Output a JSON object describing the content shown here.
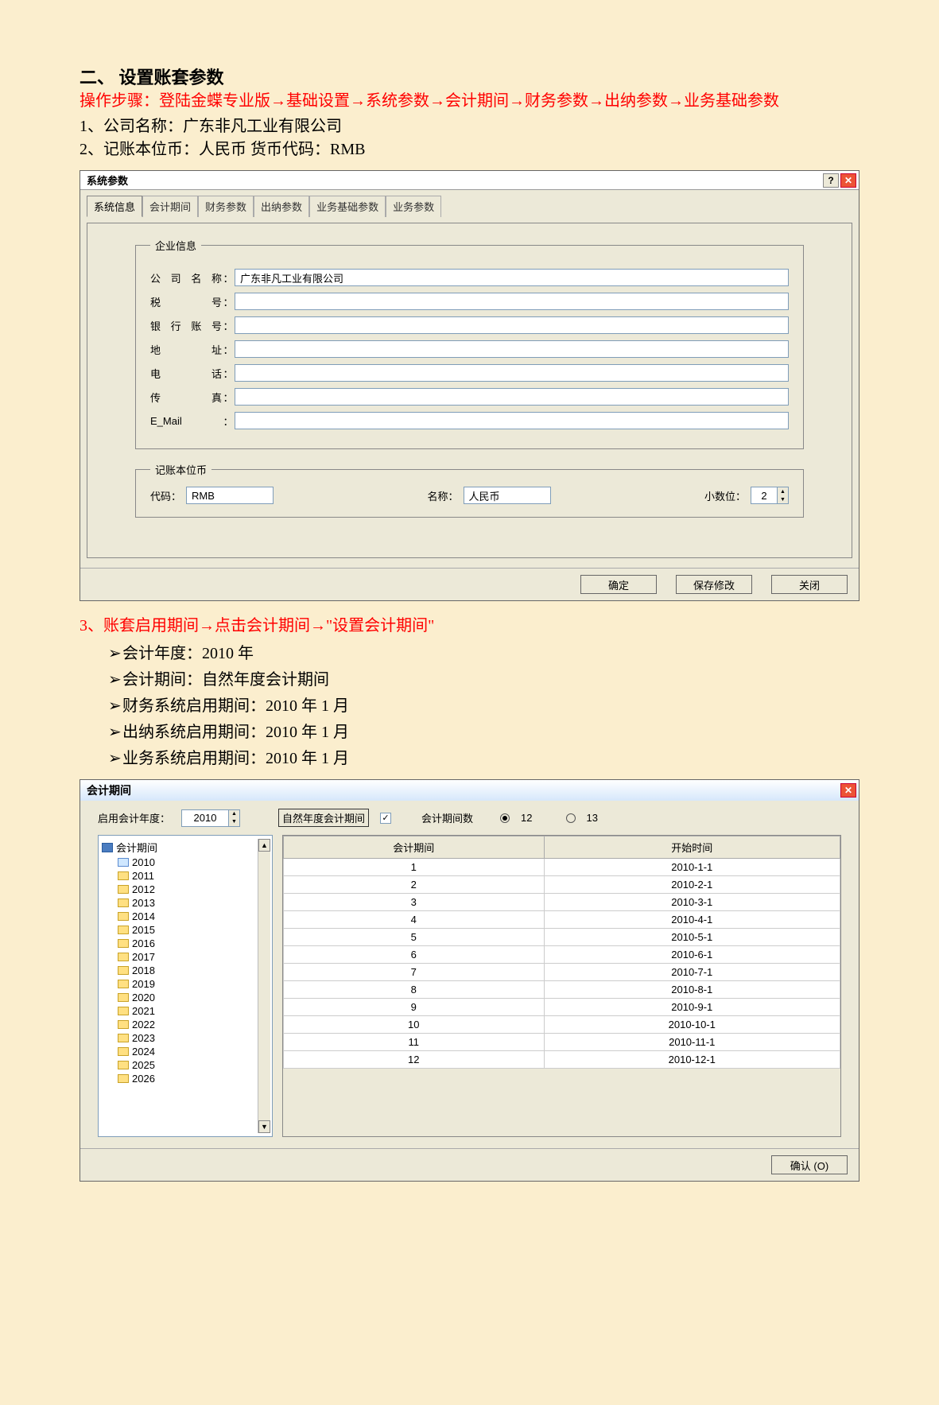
{
  "heading": "二、    设置账套参数",
  "steps_red": "操作步骤：登陆金蝶专业版→基础设置→系统参数→会计期间→财务参数→出纳参数→业务基础参数",
  "line1": "1、公司名称：广东非凡工业有限公司",
  "line2": "2、记账本位币：人民币     货币代码：RMB",
  "dlg1": {
    "title": "系统参数",
    "tabs": [
      "系统信息",
      "会计期间",
      "财务参数",
      "出纳参数",
      "业务基础参数",
      "业务参数"
    ],
    "group1": "企业信息",
    "labels": {
      "company": "公司名称",
      "tax": "税      号",
      "bank": "银行账号",
      "addr": "地      址",
      "tel": "电      话",
      "fax": "传      真",
      "email": "E_Mail"
    },
    "company_value": "广东非凡工业有限公司",
    "group2": "记账本位币",
    "code_label": "代码：",
    "code_value": "RMB",
    "name_label": "名称：",
    "name_value": "人民币",
    "dec_label": "小数位：",
    "dec_value": "2",
    "btns": {
      "ok": "确定",
      "save": "保存修改",
      "close": "关闭"
    }
  },
  "line3_red": "3、账套启用期间→点击会计期间→\"设置会计期间\"",
  "bullets": [
    "会计年度：2010 年",
    "会计期间：自然年度会计期间",
    "财务系统启用期间：2010 年 1 月",
    "出纳系统启用期间：2010 年 1 月",
    "业务系统启用期间：2010 年 1 月"
  ],
  "dlg2": {
    "title": "会计期间",
    "start_label": "启用会计年度：",
    "start_value": "2010",
    "natural_btn": "自然年度会计期间",
    "check": "✓",
    "period_count_label": "会计期间数",
    "r12": "12",
    "r13": "13",
    "tree_root": "会计期间",
    "years": [
      "2010",
      "2011",
      "2012",
      "2013",
      "2014",
      "2015",
      "2016",
      "2017",
      "2018",
      "2019",
      "2020",
      "2021",
      "2022",
      "2023",
      "2024",
      "2025",
      "2026"
    ],
    "col1": "会计期间",
    "col2": "开始时间",
    "rows": [
      {
        "p": "1",
        "d": "2010-1-1"
      },
      {
        "p": "2",
        "d": "2010-2-1"
      },
      {
        "p": "3",
        "d": "2010-3-1"
      },
      {
        "p": "4",
        "d": "2010-4-1"
      },
      {
        "p": "5",
        "d": "2010-5-1"
      },
      {
        "p": "6",
        "d": "2010-6-1"
      },
      {
        "p": "7",
        "d": "2010-7-1"
      },
      {
        "p": "8",
        "d": "2010-8-1"
      },
      {
        "p": "9",
        "d": "2010-9-1"
      },
      {
        "p": "10",
        "d": "2010-10-1"
      },
      {
        "p": "11",
        "d": "2010-11-1"
      },
      {
        "p": "12",
        "d": "2010-12-1"
      }
    ],
    "ok_btn": "确认 (O)"
  }
}
